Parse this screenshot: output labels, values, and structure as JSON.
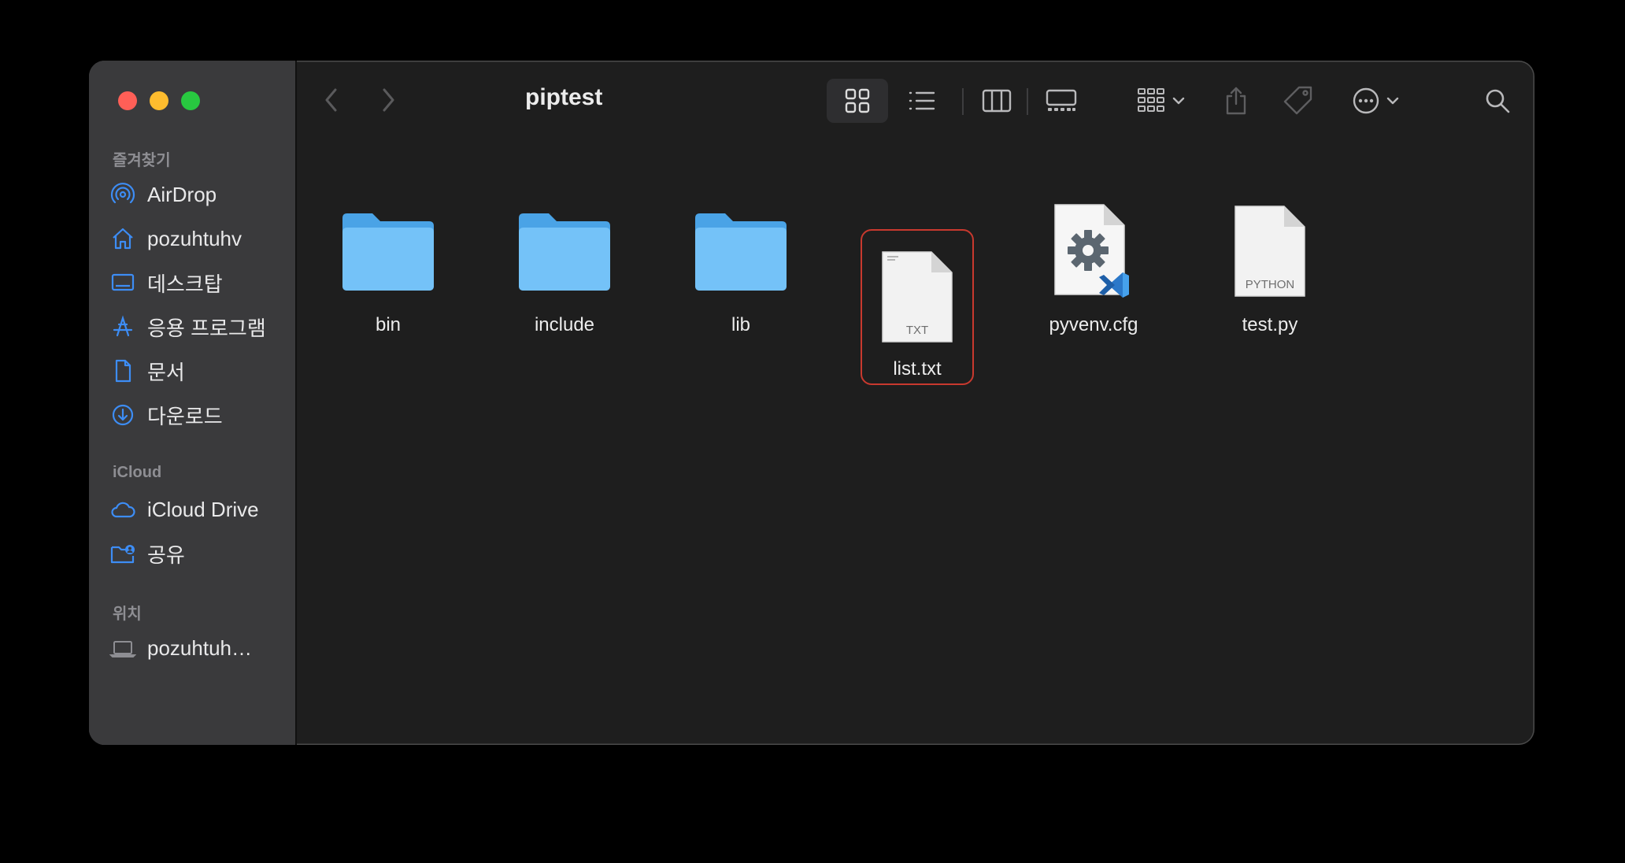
{
  "window": {
    "title": "piptest"
  },
  "sidebar": {
    "favorites_label": "즐겨찾기",
    "favorites": [
      {
        "label": "AirDrop",
        "icon": "airdrop-icon"
      },
      {
        "label": "pozuhtuhv",
        "icon": "home-icon"
      },
      {
        "label": "데스크탑",
        "icon": "desktop-icon"
      },
      {
        "label": "응용 프로그램",
        "icon": "applications-icon"
      },
      {
        "label": "문서",
        "icon": "document-icon"
      },
      {
        "label": "다운로드",
        "icon": "download-icon"
      }
    ],
    "icloud_label": "iCloud",
    "icloud": [
      {
        "label": "iCloud Drive",
        "icon": "cloud-icon"
      },
      {
        "label": "공유",
        "icon": "shared-folder-icon"
      }
    ],
    "locations_label": "위치",
    "locations": [
      {
        "label": "pozuhtuh…",
        "icon": "laptop-icon"
      }
    ]
  },
  "files": [
    {
      "name": "bin",
      "type": "folder"
    },
    {
      "name": "include",
      "type": "folder"
    },
    {
      "name": "lib",
      "type": "folder"
    },
    {
      "name": "list.txt",
      "type": "text",
      "badge": "TXT",
      "selected": true
    },
    {
      "name": "pyvenv.cfg",
      "type": "config"
    },
    {
      "name": "test.py",
      "type": "python",
      "badge": "PYTHON"
    }
  ],
  "colors": {
    "accent": "#3d8df5",
    "folder": "#6cbef5",
    "selection_border": "#c8392e"
  }
}
